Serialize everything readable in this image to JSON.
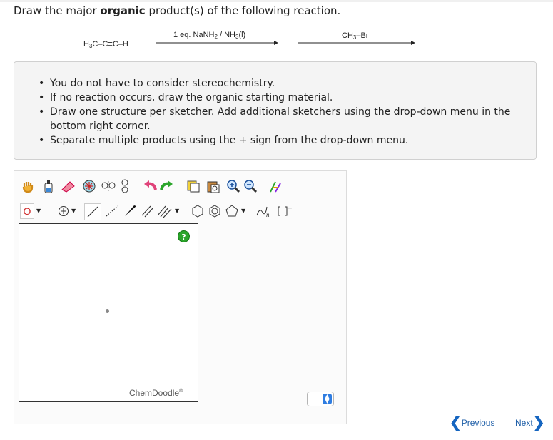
{
  "question": {
    "prefix": "Draw the major ",
    "bold": "organic",
    "suffix": " product(s) of the following reaction."
  },
  "reaction": {
    "reactant": "H₃C–C≡C–H",
    "reagent1": "1 eq. NaNH₂ / NH₃(l)",
    "reagent2": "CH₃–Br"
  },
  "instructions": [
    "You do not have to consider stereochemistry.",
    "If no reaction occurs, draw the organic starting material.",
    "Draw one structure per sketcher. Add additional sketchers using the drop-down menu in the bottom right corner.",
    "Separate multiple products using the + sign from the drop-down menu."
  ],
  "sketcher": {
    "element_label": "O",
    "help_label": "?",
    "logo": "ChemDoodle",
    "logo_mark": "®"
  },
  "nav": {
    "previous": "Previous",
    "next": "Next"
  },
  "colors": {
    "accent": "#1565c0",
    "element_red": "#cc2222",
    "help_green": "#2aa52a"
  }
}
